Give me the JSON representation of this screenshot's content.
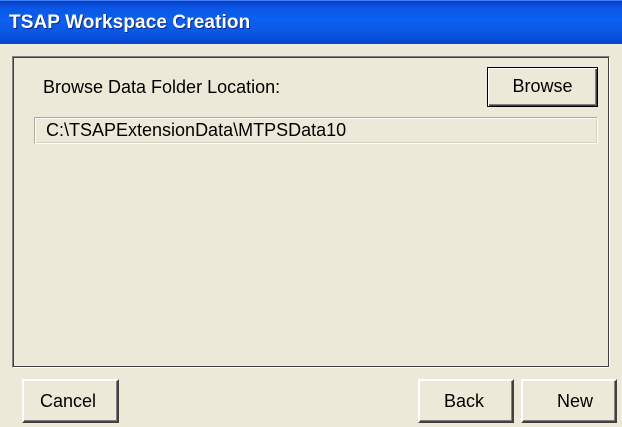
{
  "window": {
    "title": "TSAP Workspace Creation"
  },
  "browse_section": {
    "label": "Browse Data Folder Location:",
    "browse_button_label": "Browse",
    "folder_path": "C:\\TSAPExtensionData\\MTPSData10"
  },
  "footer": {
    "cancel_label": "Cancel",
    "back_label": "Back",
    "new_label": "New"
  },
  "colors": {
    "titlebar": "#0a58e6",
    "dialog_background": "#ece9d8",
    "title_text": "#ffffff"
  }
}
